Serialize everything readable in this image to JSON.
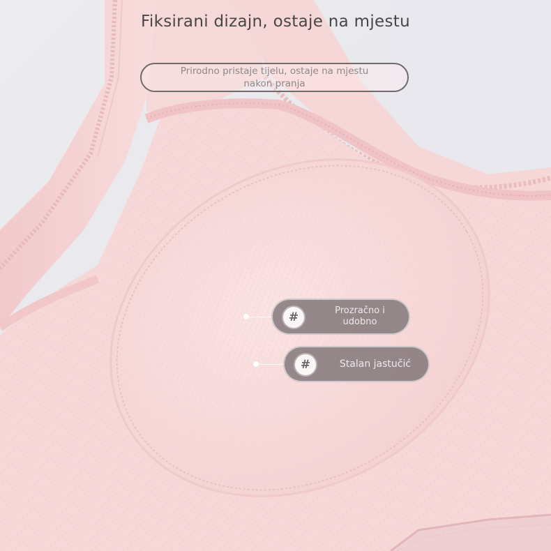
{
  "headline": "Fiksirani dizajn, ostaje na mjestu",
  "subtitle": {
    "line1": "Prirodno pristaje tijelu, ostaje na mjestu",
    "line2": "nakon pranja"
  },
  "callouts": [
    {
      "icon": "#",
      "line1": "Prozračno i",
      "line2": "udobno"
    },
    {
      "icon": "#",
      "text": "Stalan jastučić"
    }
  ],
  "colors": {
    "fabric": "#f7dcdc",
    "fabric_light": "#fbe9e8",
    "background": "#e9e9ee",
    "callout_bg": "#7a7274",
    "text_dark": "#4a4547"
  }
}
